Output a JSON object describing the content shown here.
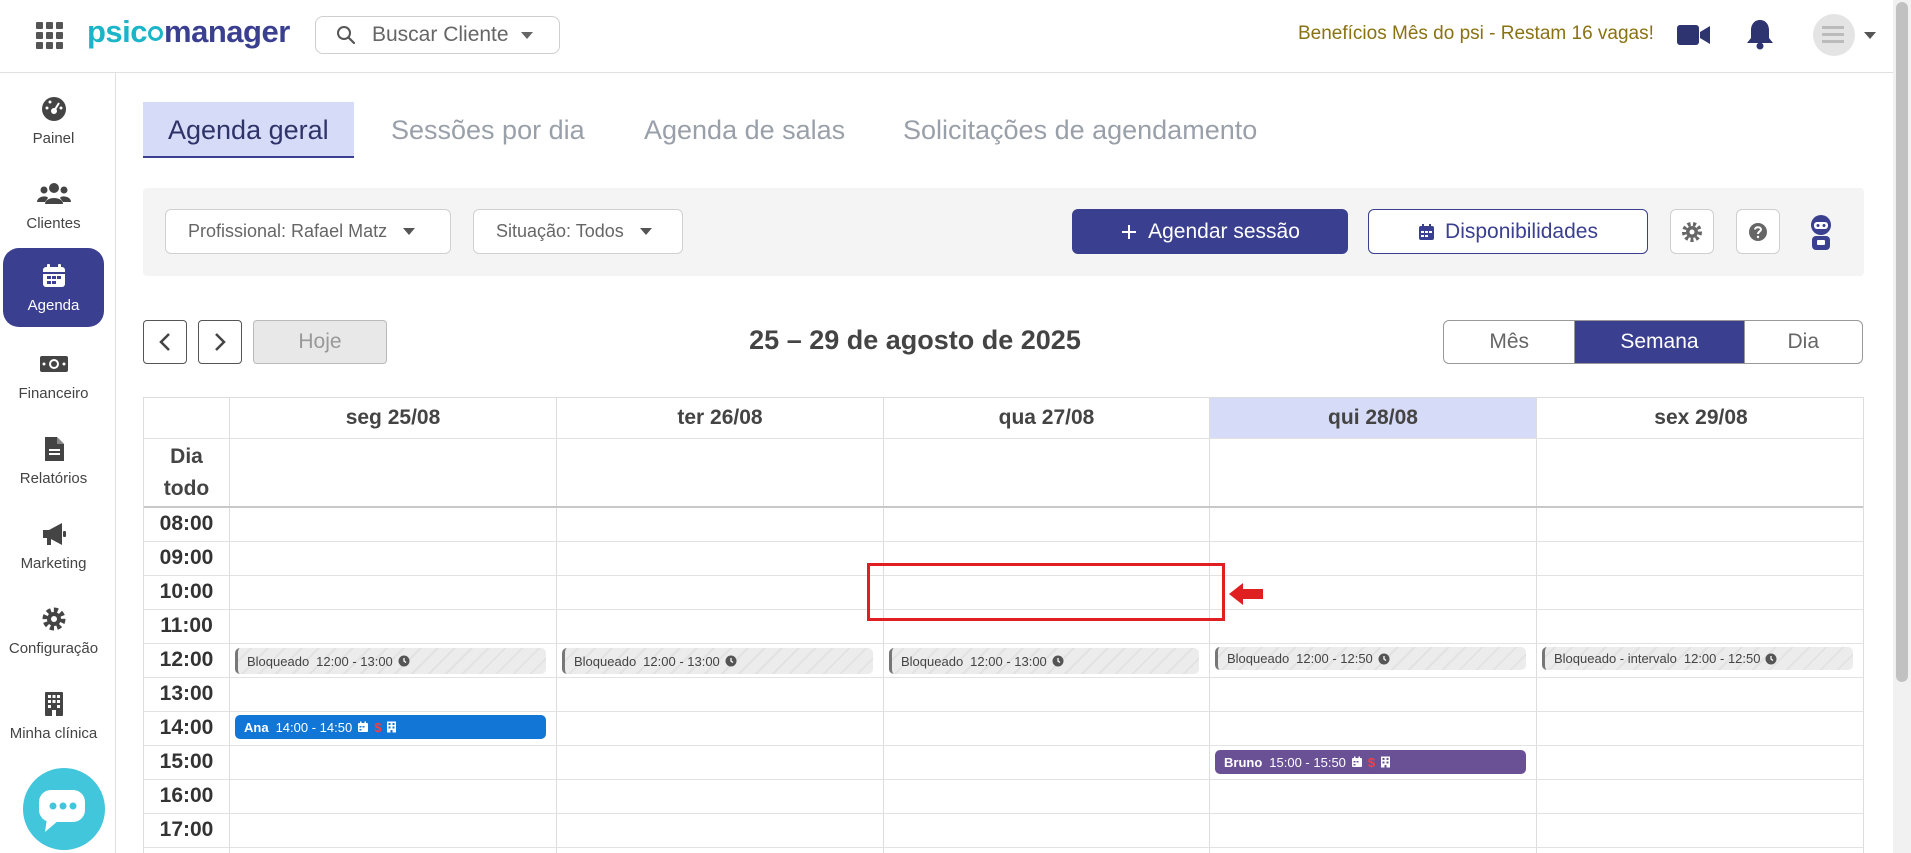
{
  "topbar": {
    "logo_part1": "psic",
    "logo_part2": "manager",
    "search_placeholder": "Buscar Cliente",
    "promo_text": "Benefícios Mês do psi - Restam 16 vagas!",
    "icons": [
      "apps-grid-icon",
      "search-icon",
      "video-camera-icon",
      "bell-icon",
      "avatar"
    ]
  },
  "sidebar": {
    "items": [
      {
        "label": "Painel",
        "icon": "dashboard-icon"
      },
      {
        "label": "Clientes",
        "icon": "users-icon"
      },
      {
        "label": "Agenda",
        "icon": "calendar-icon",
        "active": true
      },
      {
        "label": "Financeiro",
        "icon": "money-icon"
      },
      {
        "label": "Relatórios",
        "icon": "file-icon"
      },
      {
        "label": "Marketing",
        "icon": "megaphone-icon"
      },
      {
        "label": "Configuração",
        "icon": "gear-icon"
      },
      {
        "label": "Minha clínica",
        "icon": "building-icon"
      }
    ]
  },
  "tabs": [
    {
      "label": "Agenda geral",
      "active": true
    },
    {
      "label": "Sessões por dia"
    },
    {
      "label": "Agenda de salas"
    },
    {
      "label": "Solicitações de agendamento"
    }
  ],
  "filters": {
    "professional": "Profissional: Rafael Matz",
    "status": "Situação: Todos",
    "schedule_button": "Agendar sessão",
    "availability_button": "Disponibilidades"
  },
  "calendar": {
    "today_label": "Hoje",
    "title": "25 – 29 de agosto de 2025",
    "views": [
      {
        "label": "Mês"
      },
      {
        "label": "Semana",
        "active": true
      },
      {
        "label": "Dia"
      }
    ],
    "allday_label_1": "Dia",
    "allday_label_2": "todo",
    "days": [
      {
        "label": "seg 25/08"
      },
      {
        "label": "ter 26/08"
      },
      {
        "label": "qua 27/08"
      },
      {
        "label": "qui 28/08",
        "today": true
      },
      {
        "label": "sex 29/08"
      }
    ],
    "hours": [
      "08:00",
      "09:00",
      "10:00",
      "11:00",
      "12:00",
      "13:00",
      "14:00",
      "15:00",
      "16:00",
      "17:00"
    ],
    "events": [
      {
        "day": 0,
        "start": "12:00",
        "title": "Bloqueado",
        "time": "12:00 - 13:00",
        "kind": "blocked"
      },
      {
        "day": 1,
        "start": "12:00",
        "title": "Bloqueado",
        "time": "12:00 - 13:00",
        "kind": "blocked"
      },
      {
        "day": 2,
        "start": "12:00",
        "title": "Bloqueado",
        "time": "12:00 - 13:00",
        "kind": "blocked"
      },
      {
        "day": 3,
        "start": "12:00",
        "title": "Bloqueado",
        "time": "12:00 - 12:50",
        "kind": "blocked"
      },
      {
        "day": 4,
        "start": "12:00",
        "title": "Bloqueado - intervalo",
        "time": "12:00 - 12:50",
        "kind": "blocked"
      },
      {
        "day": 0,
        "start": "14:00",
        "title": "Ana",
        "time": "14:00 - 14:50",
        "kind": "blue",
        "dollar": "$"
      },
      {
        "day": 3,
        "start": "15:00",
        "title": "Bruno",
        "time": "15:00 - 15:50",
        "kind": "purple",
        "dollar": "$"
      }
    ]
  },
  "colors": {
    "primary": "#3a3f8f",
    "today_highlight": "#d6dbf7",
    "accent_red": "#e02020",
    "event_blue": "#1176d6",
    "event_purple": "#6a5196"
  }
}
